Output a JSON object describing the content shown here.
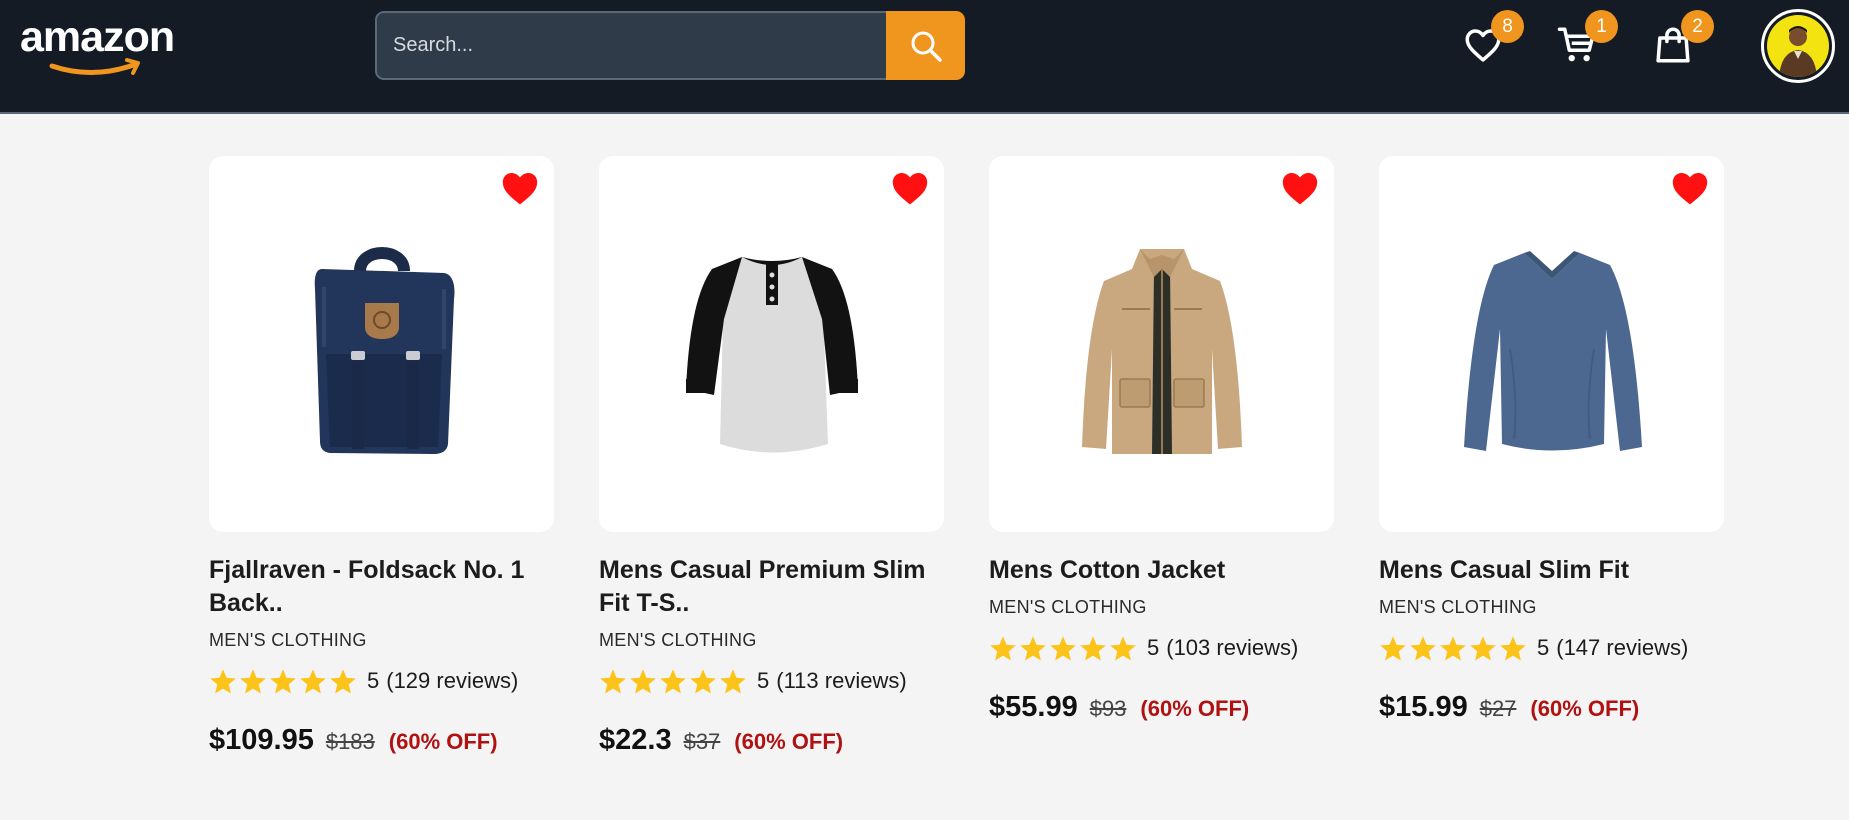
{
  "header": {
    "logo_text": "amazon",
    "search": {
      "placeholder": "Search..."
    },
    "wishlist": {
      "icon": "heart-outline-icon",
      "count": "8"
    },
    "cart": {
      "icon": "cart-icon",
      "count": "1"
    },
    "orders": {
      "icon": "shopping-bag-icon",
      "count": "2"
    },
    "avatar": {
      "icon": "user-avatar"
    }
  },
  "colors": {
    "header_bg": "#141b25",
    "accent": "#f0951e",
    "favorite": "#ff1111",
    "star": "#fcc419",
    "discount": "#b01212"
  },
  "products": [
    {
      "title": "Fjallraven - Foldsack No. 1 Back..",
      "category": "MEN'S CLOTHING",
      "rating": "5",
      "reviews": "(129 reviews)",
      "price": "$109.95",
      "old_price": "$183",
      "discount": "(60% OFF)",
      "image": "backpack"
    },
    {
      "title": "Mens Casual Premium Slim Fit T-S..",
      "category": "MEN'S CLOTHING",
      "rating": "5",
      "reviews": "(113 reviews)",
      "price": "$22.3",
      "old_price": "$37",
      "discount": "(60% OFF)",
      "image": "raglan-t-shirt"
    },
    {
      "title": "Mens Cotton Jacket",
      "category": "MEN'S CLOTHING",
      "rating": "5",
      "reviews": "(103 reviews)",
      "price": "$55.99",
      "old_price": "$93",
      "discount": "(60% OFF)",
      "image": "jacket"
    },
    {
      "title": "Mens Casual Slim Fit",
      "category": "MEN'S CLOTHING",
      "rating": "5",
      "reviews": "(147 reviews)",
      "price": "$15.99",
      "old_price": "$27",
      "discount": "(60% OFF)",
      "image": "long-sleeve-shirt"
    }
  ]
}
